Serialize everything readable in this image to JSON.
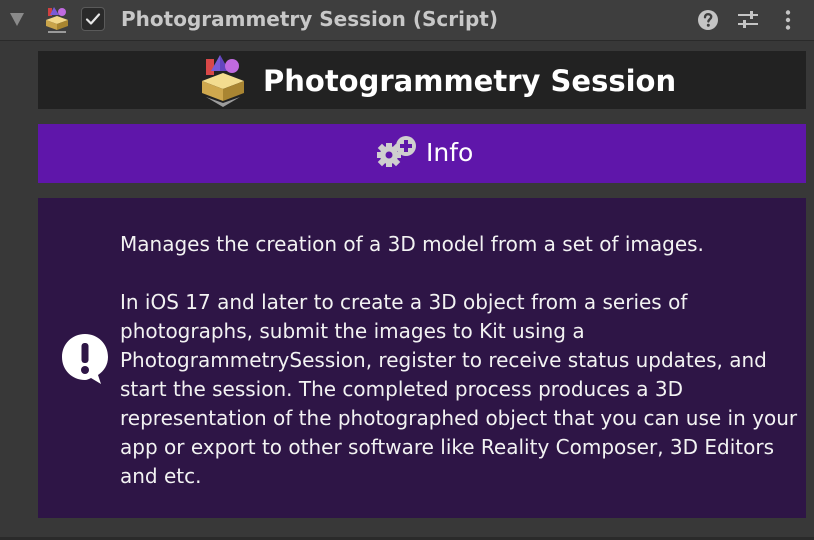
{
  "header": {
    "title": "Photogrammetry Session (Script)",
    "enabled": true,
    "icons": [
      "foldout-arrow-icon",
      "script-icon",
      "help-icon",
      "presets-icon",
      "context-menu-icon"
    ]
  },
  "banner": {
    "title": "Photogrammetry Session",
    "icon": "photogrammetry-icon"
  },
  "info_button": {
    "label": "Info",
    "icon": "gear-plus-icon"
  },
  "help_box": {
    "icon": "alert-icon",
    "summary": "Manages the creation of a 3D model from a set of images.",
    "description": "In iOS 17 and later to create a 3D object from a series of photographs, submit the images to Kit using a PhotogrammetrySession, register to receive status updates, and start the session. The completed process produces a 3D representation of the photographed object that you can use in your app or export to other software like Reality Composer, 3D Editors and etc."
  },
  "colors": {
    "panel_background": "#383838",
    "banner_background": "#222222",
    "info_button": "#5f16aa",
    "help_box_background": "#2e1546",
    "text_light": "#ffffff"
  }
}
